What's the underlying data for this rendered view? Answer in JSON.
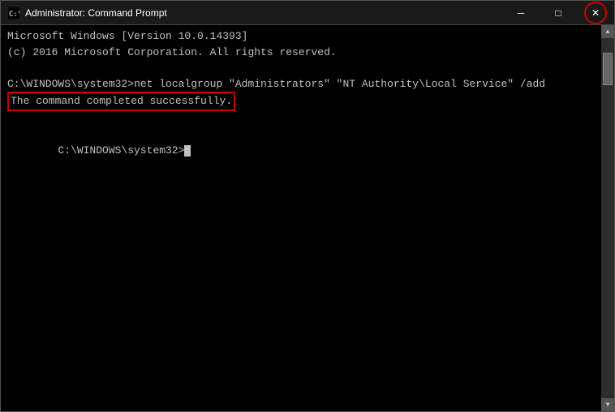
{
  "titleBar": {
    "icon": "cmd-icon",
    "title": "Administrator: Command Prompt",
    "minimizeLabel": "─",
    "maximizeLabel": "□",
    "closeLabel": "✕"
  },
  "console": {
    "line1": "Microsoft Windows [Version 10.0.14393]",
    "line2": "(c) 2016 Microsoft Corporation. All rights reserved.",
    "line3": "",
    "line4": "C:\\WINDOWS\\system32>net localgroup \"Administrators\" \"NT Authority\\Local Service\" /add",
    "line5_highlighted": "The command completed successfully.",
    "line6": "",
    "line7_prompt": "C:\\WINDOWS\\system32>"
  }
}
